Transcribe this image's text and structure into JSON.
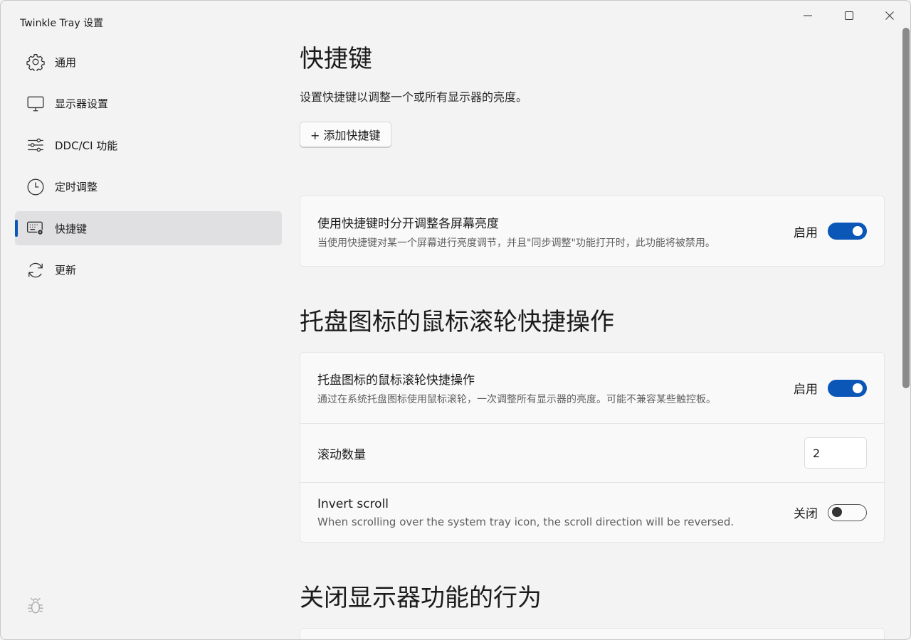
{
  "window": {
    "title": "Twinkle Tray 设置"
  },
  "sidebar": {
    "items": [
      {
        "label": "通用",
        "icon": "gear-icon"
      },
      {
        "label": "显示器设置",
        "icon": "monitor-icon"
      },
      {
        "label": "DDC/CI 功能",
        "icon": "sliders-icon"
      },
      {
        "label": "定时调整",
        "icon": "clock-icon"
      },
      {
        "label": "快捷键",
        "icon": "keyboard-gear-icon",
        "active": true
      },
      {
        "label": "更新",
        "icon": "refresh-icon"
      }
    ],
    "footer_icon": "bug-icon"
  },
  "hotkeys": {
    "title": "快捷键",
    "description": "设置快捷键以调整一个或所有显示器的亮度。",
    "add_button": "+ 添加快捷键",
    "separate_card": {
      "title": "使用快捷键时分开调整各屏幕亮度",
      "subtitle": "当使用快捷键对某一个屏幕进行亮度调节，并且\"同步调整\"功能打开时，此功能将被禁用。",
      "state_label": "启用",
      "enabled": true
    }
  },
  "tray_scroll": {
    "title": "托盘图标的鼠标滚轮快捷操作",
    "setting": {
      "title": "托盘图标的鼠标滚轮快捷操作",
      "subtitle": "通过在系统托盘图标使用鼠标滚轮，一次调整所有显示器的亮度。可能不兼容某些触控板。",
      "state_label": "启用",
      "enabled": true
    },
    "scroll_amount": {
      "label": "滚动数量",
      "value": "2"
    },
    "invert": {
      "title": "Invert scroll",
      "subtitle": "When scrolling over the system tray icon, the scroll direction will be reversed.",
      "state_label": "关闭",
      "enabled": false
    }
  },
  "close_display": {
    "title": "关闭显示器功能的行为"
  },
  "colors": {
    "accent": "#0a57b8",
    "background": "#f3f3f3",
    "card": "#f9f9f9"
  }
}
